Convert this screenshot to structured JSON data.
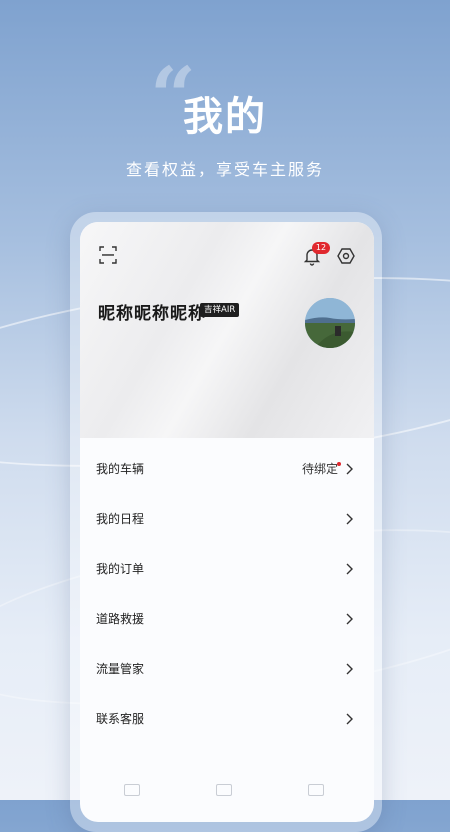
{
  "hero": {
    "quote_mark": "“",
    "title": "我的",
    "subtitle": "查看权益，享受车主服务"
  },
  "profile": {
    "nickname": "昵称昵称昵称",
    "tag": "吉祥AIR",
    "notification_count": "12"
  },
  "menu": {
    "items": [
      {
        "label": "我的车辆",
        "value": "待绑定"
      },
      {
        "label": "我的日程",
        "value": ""
      },
      {
        "label": "我的订单",
        "value": ""
      },
      {
        "label": "道路救援",
        "value": ""
      },
      {
        "label": "流量管家",
        "value": ""
      },
      {
        "label": "联系客服",
        "value": ""
      }
    ]
  },
  "colors": {
    "accent_red": "#e0282e",
    "background_blue": "#7fa2cf"
  },
  "icons": [
    "scan-icon",
    "bell-icon",
    "settings-icon",
    "chevron-right-icon"
  ]
}
